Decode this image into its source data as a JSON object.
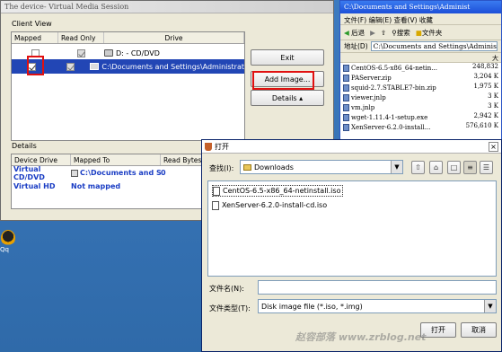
{
  "vms": {
    "title": "The device- Virtual Media Session",
    "client_view_label": "Client View",
    "columns": [
      "Mapped",
      "Read Only",
      "Drive"
    ],
    "drives": [
      {
        "mapped": false,
        "read_only": true,
        "drive": "D: - CD/DVD"
      },
      {
        "mapped": true,
        "read_only": true,
        "drive": "C:\\Documents and Settings\\Administrat"
      }
    ],
    "buttons": {
      "exit": "Exit",
      "add_image": "Add Image...",
      "details": "Details ▴"
    },
    "details_label": "Details",
    "details_columns": [
      "Device Drive",
      "Mapped To",
      "Read Bytes"
    ],
    "details_rows": [
      {
        "device": "Virtual CD/DVD",
        "mapped_to": "C:\\Documents and S...",
        "read_bytes": "0"
      },
      {
        "device": "Virtual HD",
        "mapped_to": "Not mapped",
        "read_bytes": ""
      }
    ]
  },
  "explorer": {
    "title": "C:\\Documents and Settings\\Administ",
    "menu": "文件(F)  编辑(E)  查看(V)  收藏",
    "back": "后退",
    "search": "搜索",
    "folders": "文件夹",
    "address_label": "地址(D)",
    "address": "C:\\Documents and Settings\\Administ",
    "col_size": "大",
    "files": [
      {
        "name": "CentOS-6.5-x86_64-netin...",
        "size": "248,832"
      },
      {
        "name": "PAServer.zip",
        "size": "3,204 K"
      },
      {
        "name": "squid-2.7.STABLE7-bin.zip",
        "size": "1,975 K"
      },
      {
        "name": "viewer.jnlp",
        "size": "3 K"
      },
      {
        "name": "vm.jnlp",
        "size": "3 K"
      },
      {
        "name": "wget-1.11.4-1-setup.exe",
        "size": "2,942 K"
      },
      {
        "name": "XenServer-6.2.0-install...",
        "size": "576,610 K"
      }
    ]
  },
  "desktop": {
    "icon_label": "Qq"
  },
  "dialog": {
    "title": "打开",
    "look_in_label": "查找(I):",
    "look_in_value": "Downloads",
    "files": [
      "CentOS-6.5-x86_64-netinstall.iso",
      "XenServer-6.2.0-install-cd.iso"
    ],
    "filename_label": "文件名(N):",
    "filename_value": "",
    "filetype_label": "文件类型(T):",
    "filetype_value": "Disk image file (*.iso, *.img)",
    "open_button": "打开",
    "cancel_button": "取消"
  },
  "watermark": "赵容部落 www.zrblog.net",
  "colors": {
    "selection": "#2246b5",
    "highlight_box": "#e01010",
    "link_blue": "#1a3dc4"
  }
}
